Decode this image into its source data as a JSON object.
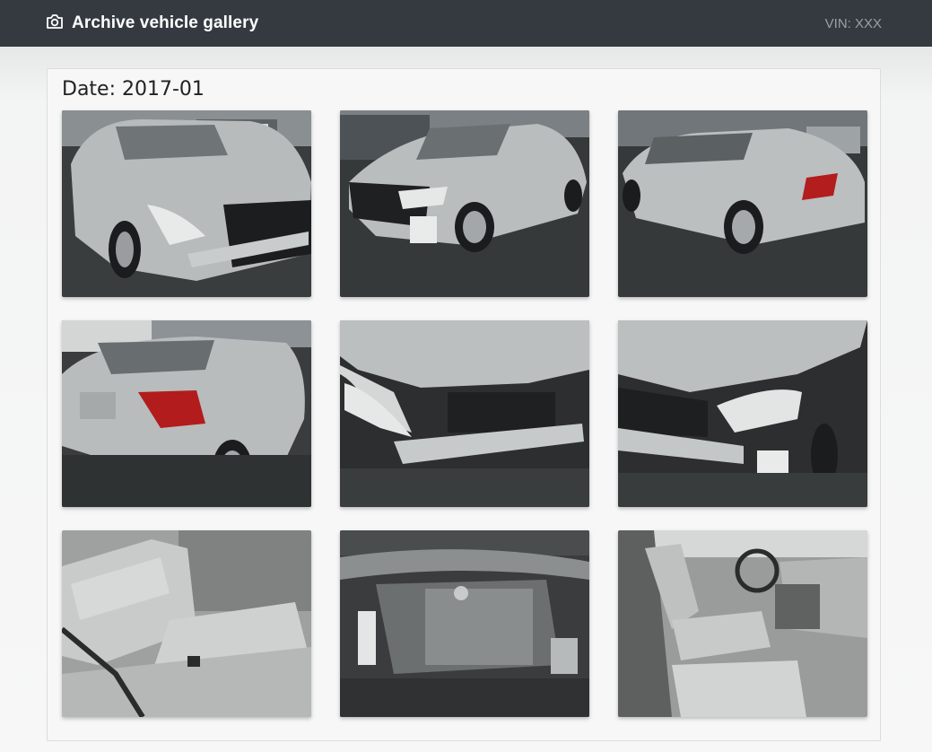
{
  "header": {
    "title": "Archive vehicle gallery",
    "icon": "camera-icon",
    "vin_label": "VIN: XXX"
  },
  "gallery": {
    "date_label": "Date: 2017-01",
    "photos": [
      {
        "subject": "front-left-damaged"
      },
      {
        "subject": "front-right-damaged"
      },
      {
        "subject": "rear-right"
      },
      {
        "subject": "rear-left"
      },
      {
        "subject": "front-damage-closeup-left"
      },
      {
        "subject": "front-damage-closeup-right"
      },
      {
        "subject": "rear-seats"
      },
      {
        "subject": "engine-bay"
      },
      {
        "subject": "front-interior"
      }
    ]
  },
  "colors": {
    "navbar": "#343a40",
    "car_silver": "#b9bcbc",
    "ground": "#2e3132"
  }
}
